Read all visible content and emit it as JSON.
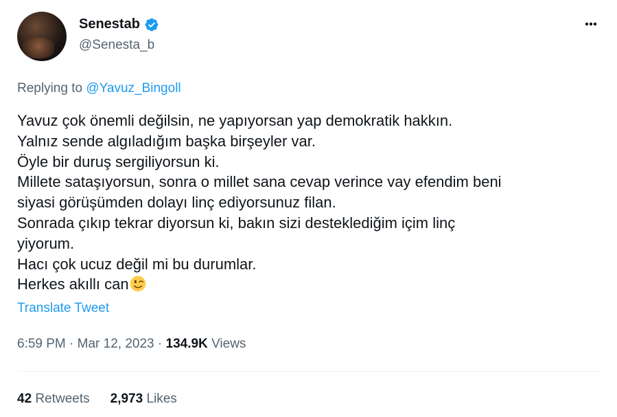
{
  "author": {
    "display_name": "Senestab",
    "handle": "@Senesta_b",
    "verified": true,
    "avatar_icon": "user-avatar-photo"
  },
  "reply": {
    "prefix": "Replying to ",
    "mention": "@Yavuz_Bingoll"
  },
  "tweet": {
    "lines": [
      "Yavuz çok önemli değilsin, ne yapıyorsan yap demokratik hakkın.",
      "Yalnız sende algıladığım başka birşeyler var.",
      "Öyle bir duruş sergiliyorsun ki.",
      "Millete sataşıyorsun, sonra o millet sana cevap verince vay efendim beni",
      "siyasi görüşümden dolayı linç ediyorsunuz filan.",
      "Sonrada çıkıp tekrar diyorsun ki, bakın sizi desteklediğim içim linç",
      "yiyorum.",
      "Hacı çok ucuz değil mi bu durumlar.",
      "Herkes akıllı can"
    ],
    "emoji": "winking-face-emoji"
  },
  "translate_label": "Translate Tweet",
  "meta": {
    "time": "6:59 PM",
    "separator": " · ",
    "date": "Mar 12, 2023",
    "views_count": "134.9K",
    "views_label": " Views"
  },
  "stats": {
    "retweets_count": "42",
    "retweets_label": " Retweets",
    "likes_count": "2,973",
    "likes_label": " Likes"
  },
  "colors": {
    "accent": "#1d9bf0",
    "text": "#0f1419",
    "secondary": "#536471",
    "divider": "#eff3f4"
  }
}
